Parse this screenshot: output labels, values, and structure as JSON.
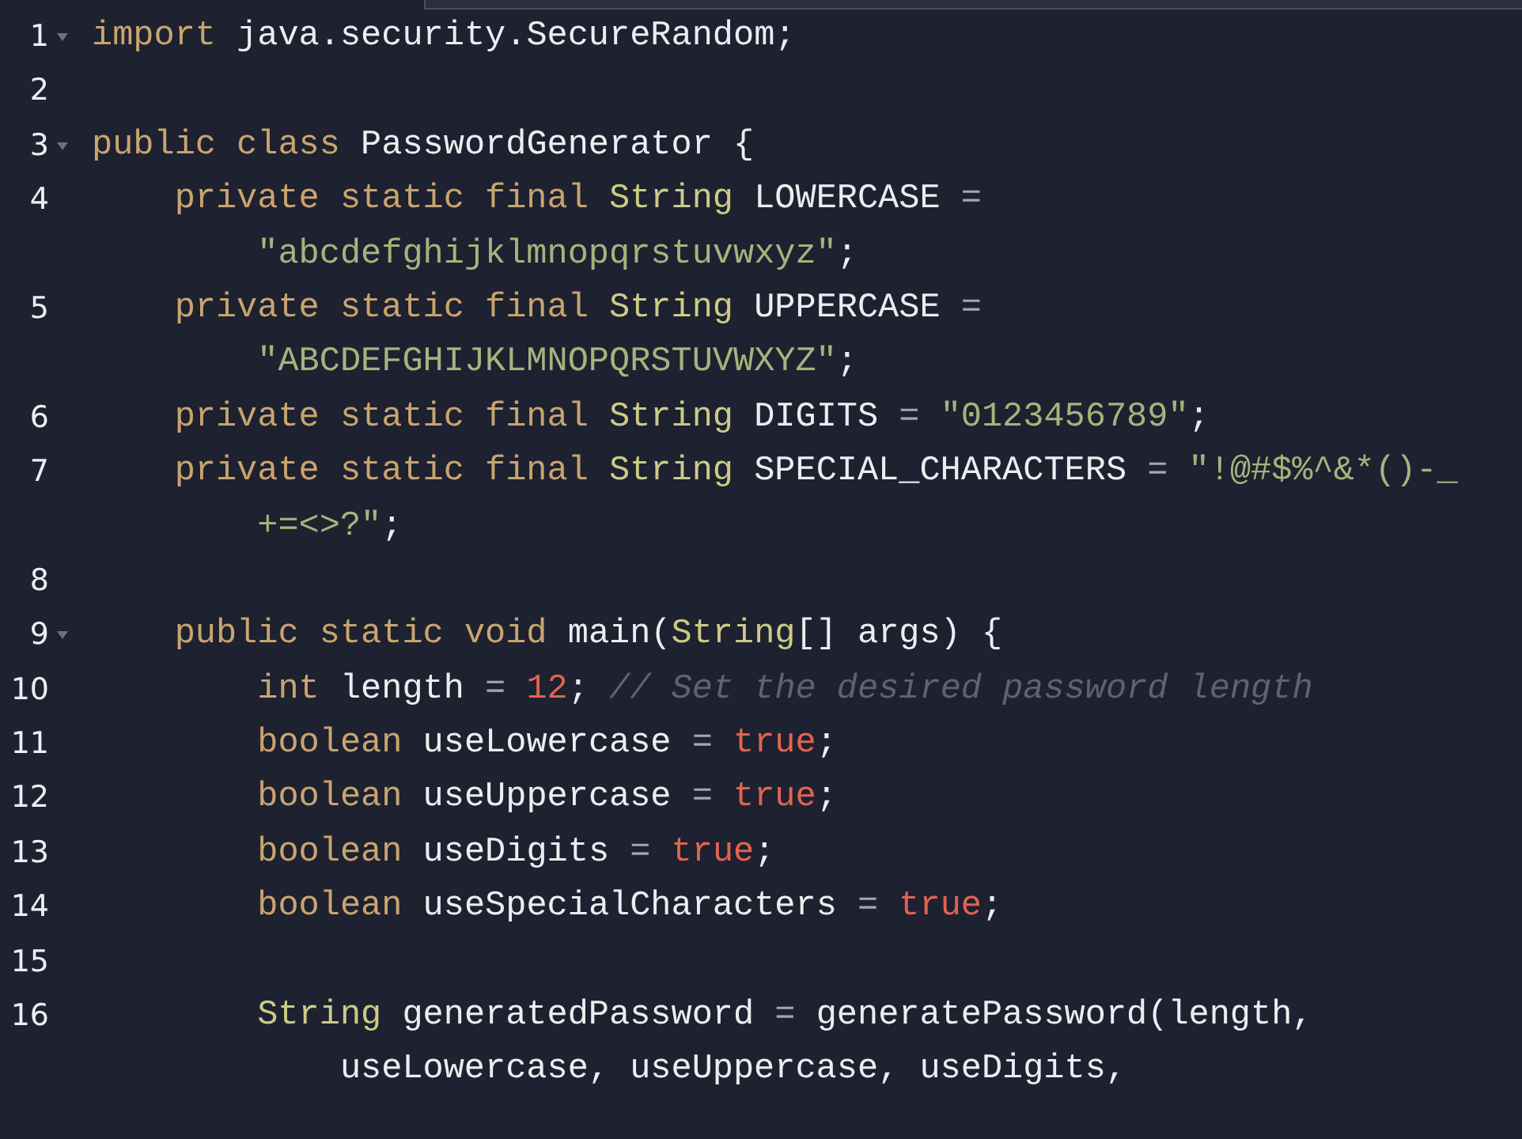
{
  "editor": {
    "lines": [
      {
        "number": "1",
        "fold": true,
        "rows": [
          {
            "parts": [
              {
                "kind": "kw",
                "text": "import"
              },
              {
                "kind": "id",
                "text": " java.security.SecureRandom;"
              }
            ]
          }
        ]
      },
      {
        "number": "2",
        "fold": false
      },
      {
        "number": "3",
        "fold": true,
        "rows": [
          {
            "parts": [
              {
                "kind": "kw",
                "text": "public class"
              },
              {
                "kind": "id",
                "text": " PasswordGenerator {"
              }
            ]
          }
        ]
      },
      {
        "number": "4",
        "fold": false,
        "rows": [
          {
            "parts": [
              {
                "kind": "kw",
                "text": "    private static final"
              },
              {
                "kind": "type",
                "text": " String"
              },
              {
                "kind": "id",
                "text": " LOWERCASE"
              },
              {
                "kind": "op",
                "text": " ="
              }
            ]
          },
          {
            "parts": [
              {
                "kind": "str",
                "text": "\"abcdefghijklmnopqrstuvwxyz\""
              },
              {
                "kind": "id",
                "text": ";"
              }
            ]
          }
        ]
      },
      {
        "number": "5",
        "fold": false,
        "rows": [
          {
            "parts": [
              {
                "kind": "kw",
                "text": "    private static final"
              },
              {
                "kind": "type",
                "text": " String"
              },
              {
                "kind": "id",
                "text": " UPPERCASE"
              },
              {
                "kind": "op",
                "text": " ="
              }
            ]
          },
          {
            "parts": [
              {
                "kind": "str",
                "text": "\"ABCDEFGHIJKLMNOPQRSTUVWXYZ\""
              },
              {
                "kind": "id",
                "text": ";"
              }
            ]
          }
        ]
      },
      {
        "number": "6",
        "fold": false,
        "rows": [
          {
            "parts": [
              {
                "kind": "kw",
                "text": "    private static final"
              },
              {
                "kind": "type",
                "text": " String"
              },
              {
                "kind": "id",
                "text": " DIGITS"
              },
              {
                "kind": "op",
                "text": " ="
              },
              {
                "kind": "str",
                "text": " \"0123456789\""
              },
              {
                "kind": "id",
                "text": ";"
              }
            ]
          }
        ]
      },
      {
        "number": "7",
        "fold": false,
        "rows": [
          {
            "parts": [
              {
                "kind": "kw",
                "text": "    private static final"
              },
              {
                "kind": "type",
                "text": " String"
              },
              {
                "kind": "id",
                "text": " SPECIAL_CHARACTERS"
              },
              {
                "kind": "op",
                "text": " ="
              },
              {
                "kind": "str",
                "text": " \"!@#$%^&*()-_"
              }
            ]
          },
          {
            "parts": [
              {
                "kind": "str",
                "text": "+=<>?\""
              },
              {
                "kind": "id",
                "text": ";"
              }
            ]
          }
        ]
      },
      {
        "number": "8",
        "fold": false
      },
      {
        "number": "9",
        "fold": true,
        "rows": [
          {
            "parts": [
              {
                "kind": "kw",
                "text": "    public static void"
              },
              {
                "kind": "id",
                "text": " main("
              },
              {
                "kind": "type",
                "text": "String"
              },
              {
                "kind": "id",
                "text": "[] args) {"
              }
            ]
          }
        ]
      },
      {
        "number": "10",
        "fold": false,
        "rows": [
          {
            "parts": [
              {
                "kind": "kw",
                "text": "        int"
              },
              {
                "kind": "id",
                "text": " length"
              },
              {
                "kind": "op",
                "text": " ="
              },
              {
                "kind": "num",
                "text": " 12"
              },
              {
                "kind": "id",
                "text": ";"
              },
              {
                "kind": "cmt",
                "text": " // Set the desired password length"
              }
            ]
          }
        ]
      },
      {
        "number": "11",
        "fold": false,
        "rows": [
          {
            "parts": [
              {
                "kind": "kw",
                "text": "        boolean"
              },
              {
                "kind": "id",
                "text": " useLowercase"
              },
              {
                "kind": "op",
                "text": " ="
              },
              {
                "kind": "num",
                "text": " true"
              },
              {
                "kind": "id",
                "text": ";"
              }
            ]
          }
        ]
      },
      {
        "number": "12",
        "fold": false,
        "rows": [
          {
            "parts": [
              {
                "kind": "kw",
                "text": "        boolean"
              },
              {
                "kind": "id",
                "text": " useUppercase"
              },
              {
                "kind": "op",
                "text": " ="
              },
              {
                "kind": "num",
                "text": " true"
              },
              {
                "kind": "id",
                "text": ";"
              }
            ]
          }
        ]
      },
      {
        "number": "13",
        "fold": false,
        "rows": [
          {
            "parts": [
              {
                "kind": "kw",
                "text": "        boolean"
              },
              {
                "kind": "id",
                "text": " useDigits"
              },
              {
                "kind": "op",
                "text": " ="
              },
              {
                "kind": "num",
                "text": " true"
              },
              {
                "kind": "id",
                "text": ";"
              }
            ]
          }
        ]
      },
      {
        "number": "14",
        "fold": false,
        "rows": [
          {
            "parts": [
              {
                "kind": "kw",
                "text": "        boolean"
              },
              {
                "kind": "id",
                "text": " useSpecialCharacters"
              },
              {
                "kind": "op",
                "text": " ="
              },
              {
                "kind": "num",
                "text": " true"
              },
              {
                "kind": "id",
                "text": ";"
              }
            ]
          }
        ]
      },
      {
        "number": "15",
        "fold": false
      },
      {
        "number": "16",
        "fold": false,
        "rows": [
          {
            "parts": [
              {
                "kind": "type",
                "text": "        String"
              },
              {
                "kind": "id",
                "text": " generatedPassword"
              },
              {
                "kind": "op",
                "text": " ="
              },
              {
                "kind": "id",
                "text": " generatePassword(length,"
              }
            ]
          },
          {
            "parts": [
              {
                "kind": "id",
                "text": "useLowercase, useUppercase, useDigits,"
              }
            ]
          }
        ]
      }
    ]
  }
}
